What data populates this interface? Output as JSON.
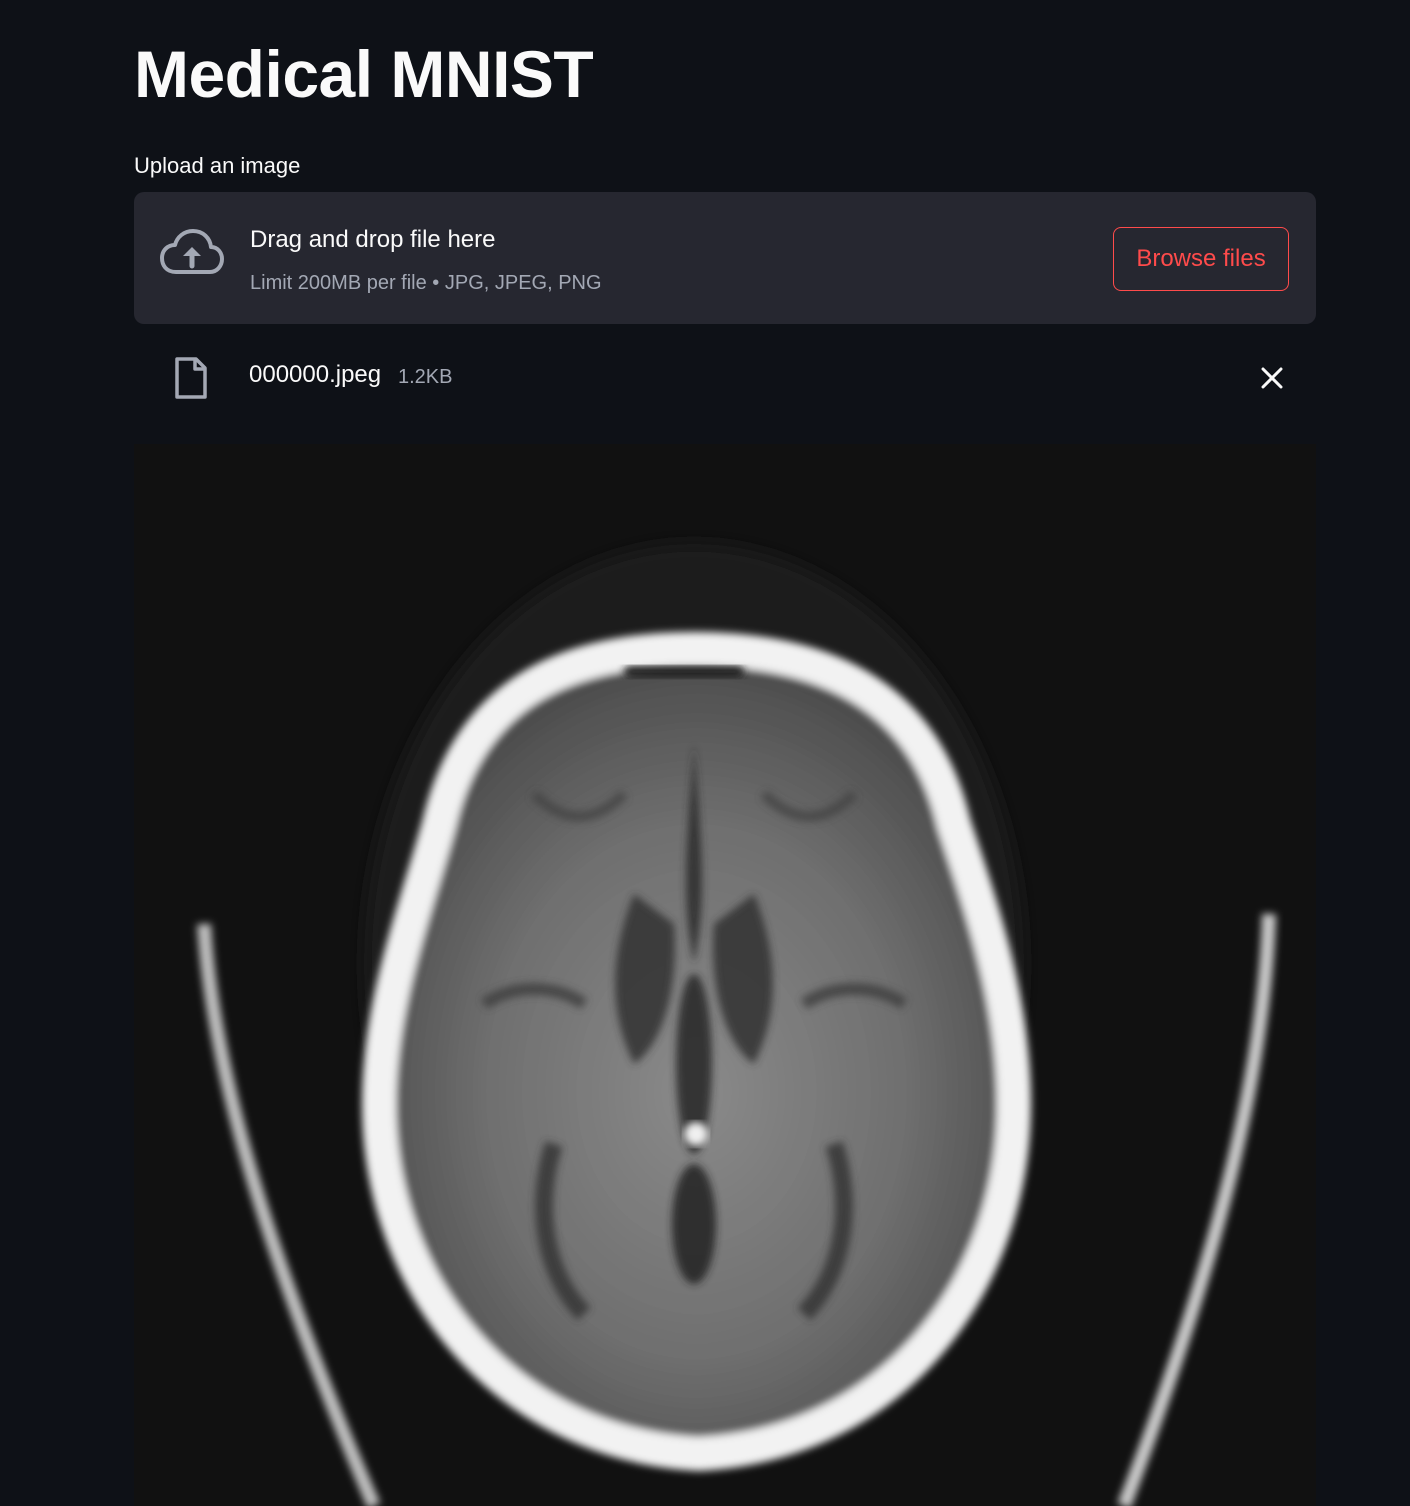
{
  "page": {
    "title": "Medical MNIST"
  },
  "uploader": {
    "label": "Upload an image",
    "drop_text": "Drag and drop file here",
    "limit_text": "Limit 200MB per file • JPG, JPEG, PNG",
    "browse_label": "Browse files",
    "icon": "cloud-upload-icon"
  },
  "uploaded_file": {
    "name": "000000.jpeg",
    "size": "1.2KB",
    "icon": "file-icon",
    "remove_icon": "close-icon"
  },
  "image": {
    "description_icon": "brain-ct-scan-image"
  },
  "colors": {
    "background": "#0e1117",
    "dropzone": "#262730",
    "accent": "#ff4b4b",
    "muted_text": "#a3a8b4"
  }
}
